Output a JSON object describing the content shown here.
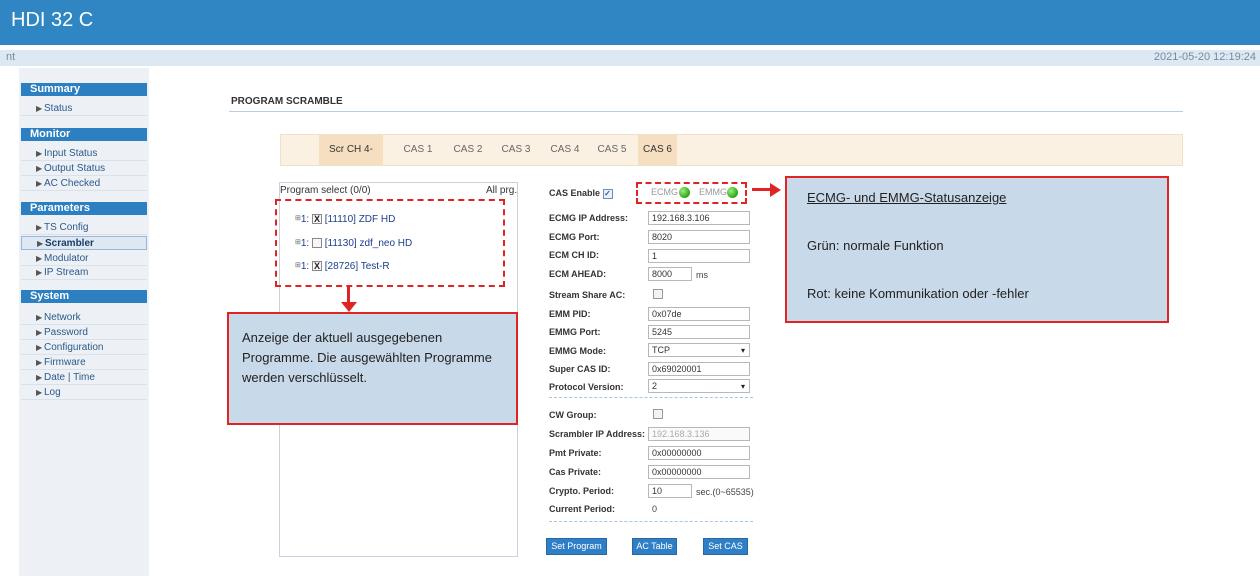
{
  "app": {
    "title": "HDI 32 C",
    "subbar_left": "nt",
    "timestamp": "2021-05-20 12:19:24"
  },
  "sidebar": {
    "summary": {
      "title": "Summary",
      "items": [
        "Status"
      ]
    },
    "monitor": {
      "title": "Monitor",
      "items": [
        "Input Status",
        "Output Status",
        "AC Checked"
      ]
    },
    "parameters": {
      "title": "Parameters",
      "items": [
        "TS Config",
        "Scrambler",
        "Modulator",
        "IP Stream"
      ],
      "active": "Scrambler"
    },
    "system": {
      "title": "System",
      "items": [
        "Network",
        "Password",
        "Configuration",
        "Firmware",
        "Date | Time",
        "Log"
      ]
    },
    "arrow_glyph": "▶"
  },
  "page": {
    "title": "PROGRAM SCRAMBLE"
  },
  "tabs": [
    {
      "label": "Scr CH 4-",
      "active": true
    },
    {
      "label": "CAS 1"
    },
    {
      "label": "CAS 2"
    },
    {
      "label": "CAS 3"
    },
    {
      "label": "CAS 4"
    },
    {
      "label": "CAS 5"
    },
    {
      "label": "CAS 6",
      "active": true
    }
  ],
  "program_list": {
    "header_left": "Program select (0/0)",
    "header_right": "All prg.",
    "rows": [
      {
        "prefix": "1:",
        "checked": true,
        "check_glyph": "X",
        "label": "[11110] ZDF HD"
      },
      {
        "prefix": "1:",
        "checked": false,
        "check_glyph": "",
        "label": "[11130] zdf_neo HD"
      },
      {
        "prefix": "1:",
        "checked": true,
        "check_glyph": "X",
        "label": "[28726] Test-R"
      }
    ]
  },
  "annotation_left": {
    "text": "Anzeige der aktuell ausgegebenen Programme. Die ausgewählten Programme werden verschlüsselt."
  },
  "annotation_right": {
    "line1": "ECMG- und EMMG-Statusanzeige",
    "line2": "Grün: normale Funktion",
    "line3": "Rot: keine Kommunikation oder -fehler"
  },
  "cas_form": {
    "cas_enable_label": "CAS Enable",
    "cas_enable_checked": true,
    "ecmg_status_label": "ECMG",
    "emmg_status_label": "EMMG",
    "status_color": "#2aa614",
    "ecmg_ip_label": "ECMG IP Address:",
    "ecmg_ip": "192.168.3.106",
    "ecmg_port_label": "ECMG Port:",
    "ecmg_port": "8020",
    "ecm_ch_id_label": "ECM CH ID:",
    "ecm_ch_id": "1",
    "ecm_ahead_label": "ECM AHEAD:",
    "ecm_ahead": "8000",
    "ecm_ahead_unit": "ms",
    "stream_share_label": "Stream Share AC:",
    "emm_pid_label": "EMM PID:",
    "emm_pid": "0x07de",
    "emmg_port_label": "EMMG Port:",
    "emmg_port": "5245",
    "emmg_mode_label": "EMMG Mode:",
    "emmg_mode": "TCP",
    "super_cas_label": "Super CAS ID:",
    "super_cas": "0x69020001",
    "protocol_label": "Protocol Version:",
    "protocol": "2",
    "cw_group_label": "CW Group:",
    "scrambler_ip_label": "Scrambler IP Address:",
    "scrambler_ip": "192.168.3.136",
    "pmt_private_label": "Pmt Private:",
    "pmt_private": "0x00000000",
    "cas_private_label": "Cas Private:",
    "cas_private": "0x00000000",
    "crypto_period_label": "Crypto. Period:",
    "crypto_period": "10",
    "crypto_period_unit": "sec.(0~65535)",
    "current_period_label": "Current Period:",
    "current_period": "0"
  },
  "buttons": {
    "set_program": "Set Program",
    "ac_table": "AC Table",
    "set_cas": "Set CAS"
  },
  "glyphs": {
    "expand": "⊞",
    "caret": "▾"
  }
}
